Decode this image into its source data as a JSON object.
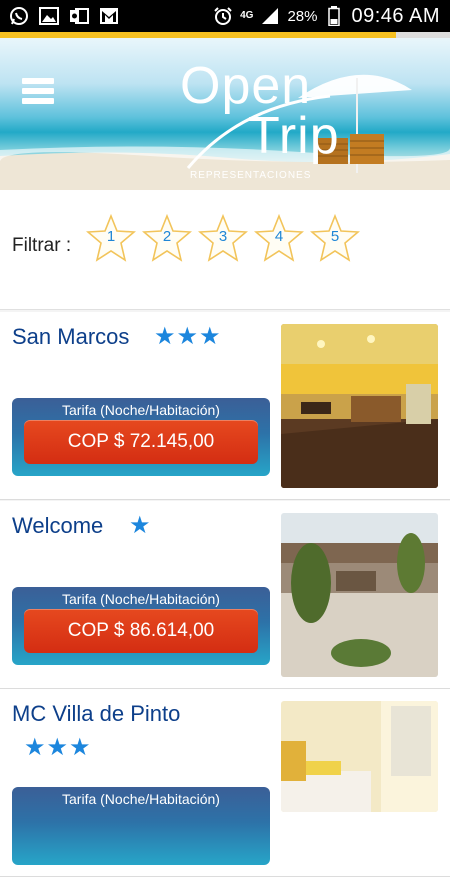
{
  "status_bar": {
    "network": "4G",
    "battery": "28%",
    "time": "09:46 AM"
  },
  "page_progress": 0.88,
  "header": {
    "logo_line1": "Open",
    "logo_line2": "Trip",
    "logo_tagline": "REPRESENTACIONES"
  },
  "filter": {
    "label": "Filtrar :",
    "stars": [
      "1",
      "2",
      "3",
      "4",
      "5"
    ]
  },
  "rate_label": "Tarifa (Noche/Habitación)",
  "hotels": [
    {
      "name": "San Marcos",
      "stars": "★★★",
      "rating": 3,
      "price": "COP $ 72.145,00"
    },
    {
      "name": "Welcome",
      "stars": "★",
      "rating": 1,
      "price": "COP $ 86.614,00"
    },
    {
      "name": "MC Villa de Pinto",
      "stars": "★★★",
      "rating": 3,
      "price": ""
    }
  ],
  "colors": {
    "accent_star": "#1c86dd",
    "hotel_name": "#0d3f8a",
    "price_button": "#d42d12",
    "progress": "#f6c021"
  }
}
